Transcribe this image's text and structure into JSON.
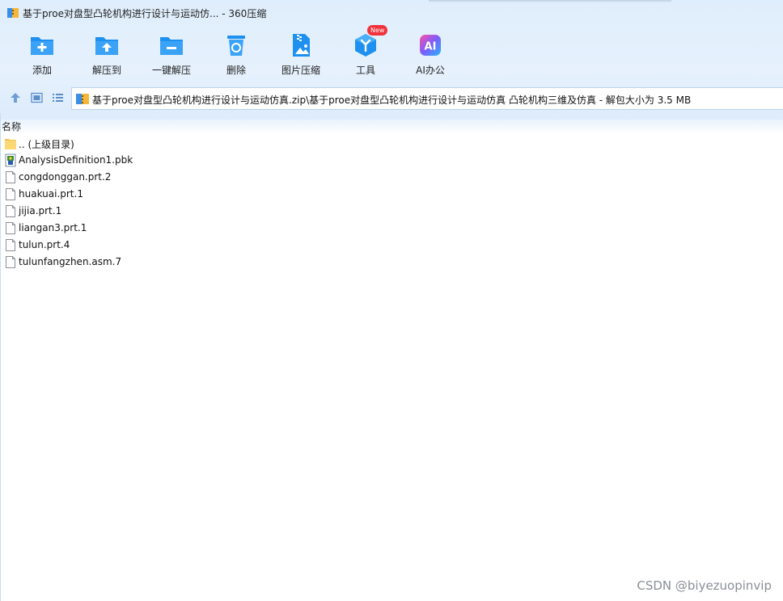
{
  "window": {
    "title": "基于proe对盘型凸轮机构进行设计与运动仿... - 360压缩"
  },
  "toolbar": {
    "add_label": "添加",
    "extract_label": "解压到",
    "onekey_label": "一键解压",
    "delete_label": "删除",
    "imgzip_label": "图片压缩",
    "tools_label": "工具",
    "tools_badge": "New",
    "ai_label": "AI办公",
    "ai_icon_text": "AI",
    "accent_color": "#1e90f0"
  },
  "pathbar": {
    "path": "基于proe对盘型凸轮机构进行设计与运动仿真.zip\\基于proe对盘型凸轮机构进行设计与运动仿真 凸轮机构三维及仿真 - 解包大小为 3.5 MB"
  },
  "list": {
    "column_name": "名称",
    "items": [
      {
        "name": ".. (上级目录)",
        "icon": "folder-icon"
      },
      {
        "name": "AnalysisDefinition1.pbk",
        "icon": "pbk-file-icon"
      },
      {
        "name": "congdonggan.prt.2",
        "icon": "file-icon"
      },
      {
        "name": "huakuai.prt.1",
        "icon": "file-icon"
      },
      {
        "name": "jijia.prt.1",
        "icon": "file-icon"
      },
      {
        "name": "liangan3.prt.1",
        "icon": "file-icon"
      },
      {
        "name": "tulun.prt.4",
        "icon": "file-icon"
      },
      {
        "name": "tulunfangzhen.asm.7",
        "icon": "file-icon"
      }
    ]
  },
  "watermark": "CSDN @biyezuopinvip"
}
